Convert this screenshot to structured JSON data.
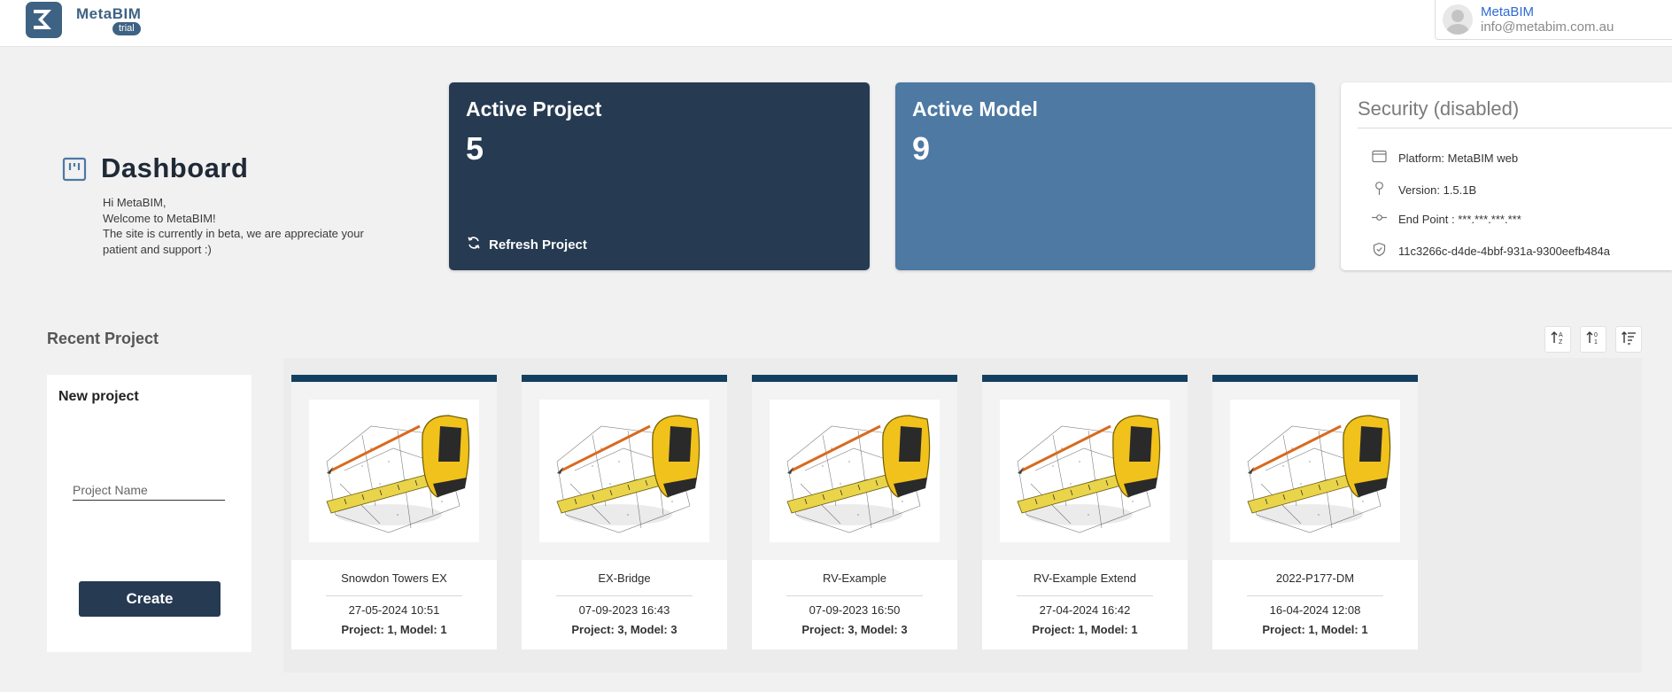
{
  "header": {
    "brand": "MetaBIM",
    "badge": "trial",
    "user_name": "MetaBIM",
    "user_email": "info@metabim.com.au"
  },
  "dashboard": {
    "title": "Dashboard",
    "welcome_lines": [
      "Hi MetaBIM,",
      "Welcome to MetaBIM!",
      "The site is currently in beta, we are appreciate your",
      "patient and support :)"
    ]
  },
  "cards": {
    "active_project": {
      "title": "Active Project",
      "value": "5",
      "action": "Refresh Project"
    },
    "active_model": {
      "title": "Active Model",
      "value": "9"
    },
    "security": {
      "title": "Security (disabled)",
      "platform": "Platform: MetaBIM web",
      "version": "Version: 1.5.1B",
      "endpoint": "End Point : ***.***.***.***",
      "id": "11c3266c-d4de-4bbf-931a-9300eefb484a"
    }
  },
  "recent": {
    "title": "Recent Project",
    "new_project": {
      "title": "New project",
      "placeholder": "Project Name",
      "create_label": "Create"
    },
    "projects": [
      {
        "name": "Snowdon Towers EX",
        "date": "27-05-2024 10:51",
        "meta": "Project: 1, Model: 1"
      },
      {
        "name": "EX-Bridge",
        "date": "07-09-2023 16:43",
        "meta": "Project: 3, Model: 3"
      },
      {
        "name": "RV-Example",
        "date": "07-09-2023 16:50",
        "meta": "Project: 3, Model: 3"
      },
      {
        "name": "RV-Example Extend",
        "date": "27-04-2024 16:42",
        "meta": "Project: 1, Model: 1"
      },
      {
        "name": "2022-P177-DM",
        "date": "16-04-2024 12:08",
        "meta": "Project: 1, Model: 1"
      }
    ]
  },
  "colors": {
    "primary": "#263a52",
    "secondary": "#4d79a3",
    "accent_bar": "#14405f",
    "link": "#2f6bd3"
  },
  "icons": {
    "logo": "metabim-logo-icon",
    "dashboard": "dashboard-icon",
    "refresh": "refresh-icon",
    "platform": "browser-window-icon",
    "version": "pin-icon",
    "endpoint": "commit-icon",
    "id": "shield-check-icon",
    "sort": [
      "sort-alpha-icon",
      "sort-numeric-icon",
      "sort-filter-icon"
    ],
    "project_thumbnail": "tape-measure-image"
  }
}
